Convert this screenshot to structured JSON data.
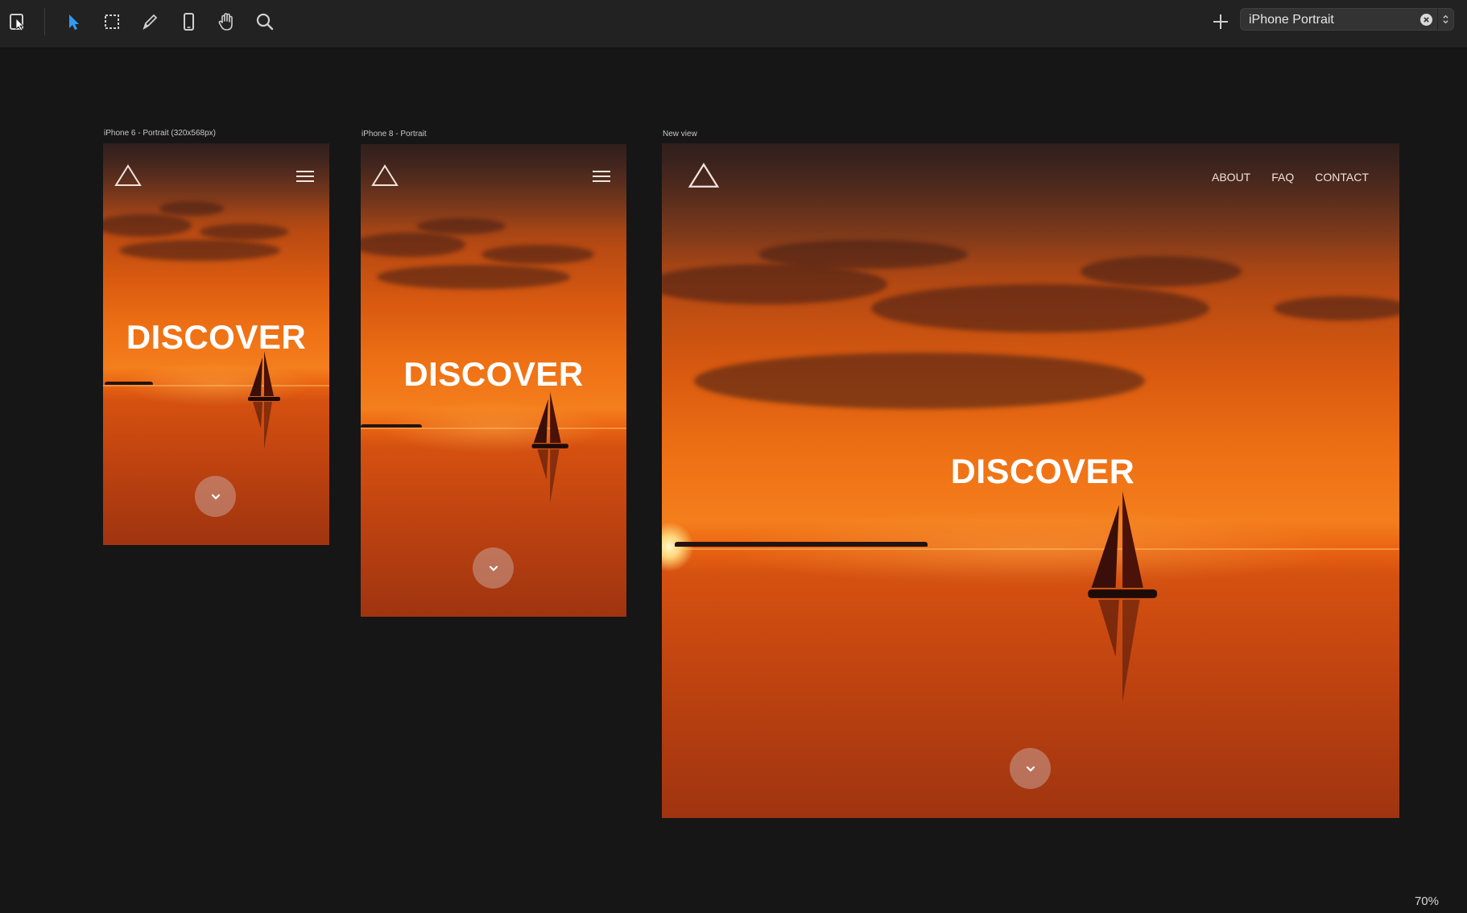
{
  "toolbar": {
    "tools": [
      "frame-icon",
      "select-arrow-icon",
      "marquee-select-icon",
      "pen-icon",
      "device-icon",
      "hand-icon",
      "search-icon"
    ],
    "add_icon": "plus-icon",
    "view_select": {
      "value": "iPhone Portrait"
    }
  },
  "artboards": [
    {
      "label": "iPhone 6 - Portrait (320x568px)",
      "hero_title": "DISCOVER",
      "menu": "hamburger-icon"
    },
    {
      "label": "iPhone 8 - Portrait",
      "hero_title": "DISCOVER",
      "menu": "hamburger-icon"
    },
    {
      "label": "New view",
      "hero_title": "DISCOVER",
      "nav": [
        "ABOUT",
        "FAQ",
        "CONTACT"
      ]
    }
  ],
  "colors": {
    "accent": "#2f9bf3",
    "sunset_top": "#3b2622",
    "sunset_mid": "#f47e1c",
    "sunset_bottom": "#9f3410"
  },
  "status": {
    "zoom": "70%"
  }
}
